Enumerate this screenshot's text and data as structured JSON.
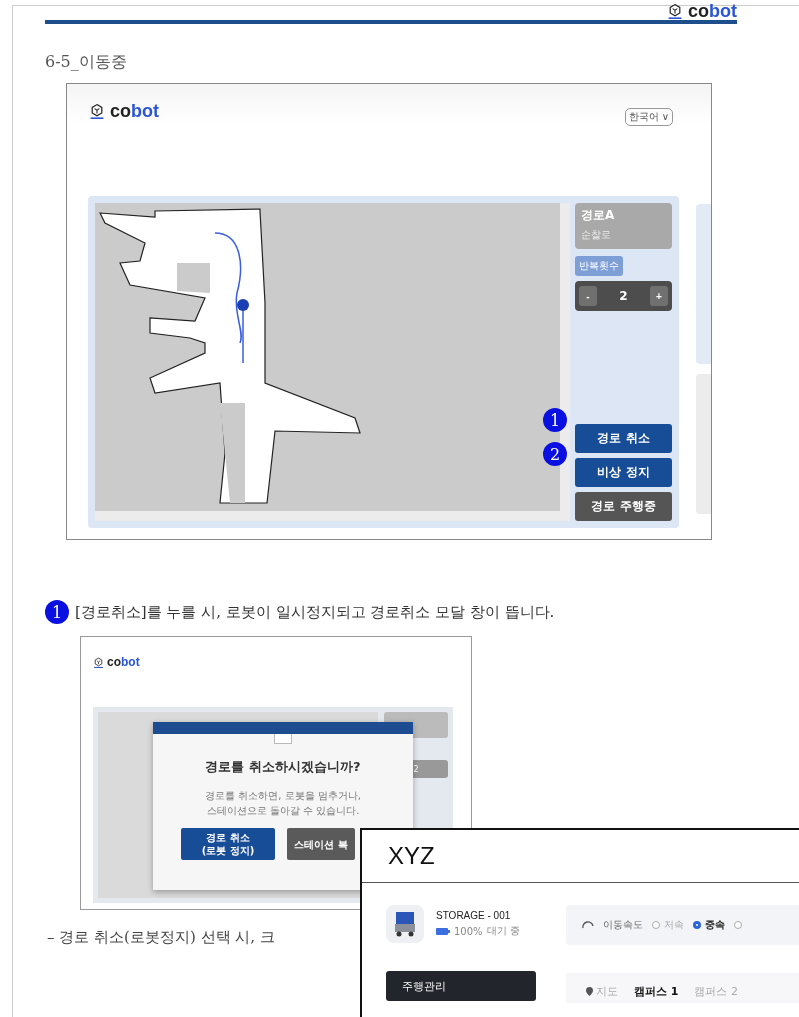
{
  "header": {
    "logo": "cobot"
  },
  "section_title": "6-5_이동중",
  "figure_1": {
    "logo": "cobot",
    "language": "한국어 ∨",
    "route": {
      "name": "경로A",
      "subtitle": "순찰로"
    },
    "repeat_label": "반복횟수",
    "stepper": {
      "minus": "-",
      "value": "2",
      "plus": "+"
    },
    "buttons": [
      {
        "label": "경로 취소",
        "kind": "primary",
        "marker": "1"
      },
      {
        "label": "비상 정지",
        "kind": "primary",
        "marker": "2"
      },
      {
        "label": "경로 주행중",
        "kind": "secondary"
      }
    ]
  },
  "note_1": {
    "marker": "1",
    "text": "[경로취소]를 누를 시, 로봇이 일시정지되고 경로취소 모달 창이 뜹니다."
  },
  "figure_2": {
    "logo": "cobot",
    "stepper_value": "2",
    "modal": {
      "title": "경로를 취소하시겠습니까?",
      "message": "경로를 취소하면, 로봇을 멈추거나,\n스테이션으로 돌아갈 수 있습니다.",
      "buttons": [
        {
          "label": "경로 취소\n(로봇 정지)",
          "kind": "primary"
        },
        {
          "label": "스테이션 복",
          "kind": "secondary"
        }
      ]
    }
  },
  "note_2": "– 경로 취소(로봇정지) 선택 시, 크",
  "overlay": {
    "title": "XYZ",
    "robot": {
      "name": "STORAGE - 001",
      "battery": "100%",
      "status": "대기 중"
    },
    "speed": {
      "label": "이동속도",
      "options": [
        {
          "label": "저속",
          "selected": false
        },
        {
          "label": "중속",
          "selected": true
        },
        {
          "selected": false
        }
      ]
    },
    "sidebar": [
      {
        "label": "주행관리",
        "selected": true
      }
    ],
    "tabs": [
      {
        "label": "지도",
        "kind": "map",
        "selected": false
      },
      {
        "label": "캠퍼스 1",
        "kind": "text",
        "selected": true
      },
      {
        "label": "캠퍼스 2",
        "kind": "text",
        "selected": false
      }
    ]
  }
}
